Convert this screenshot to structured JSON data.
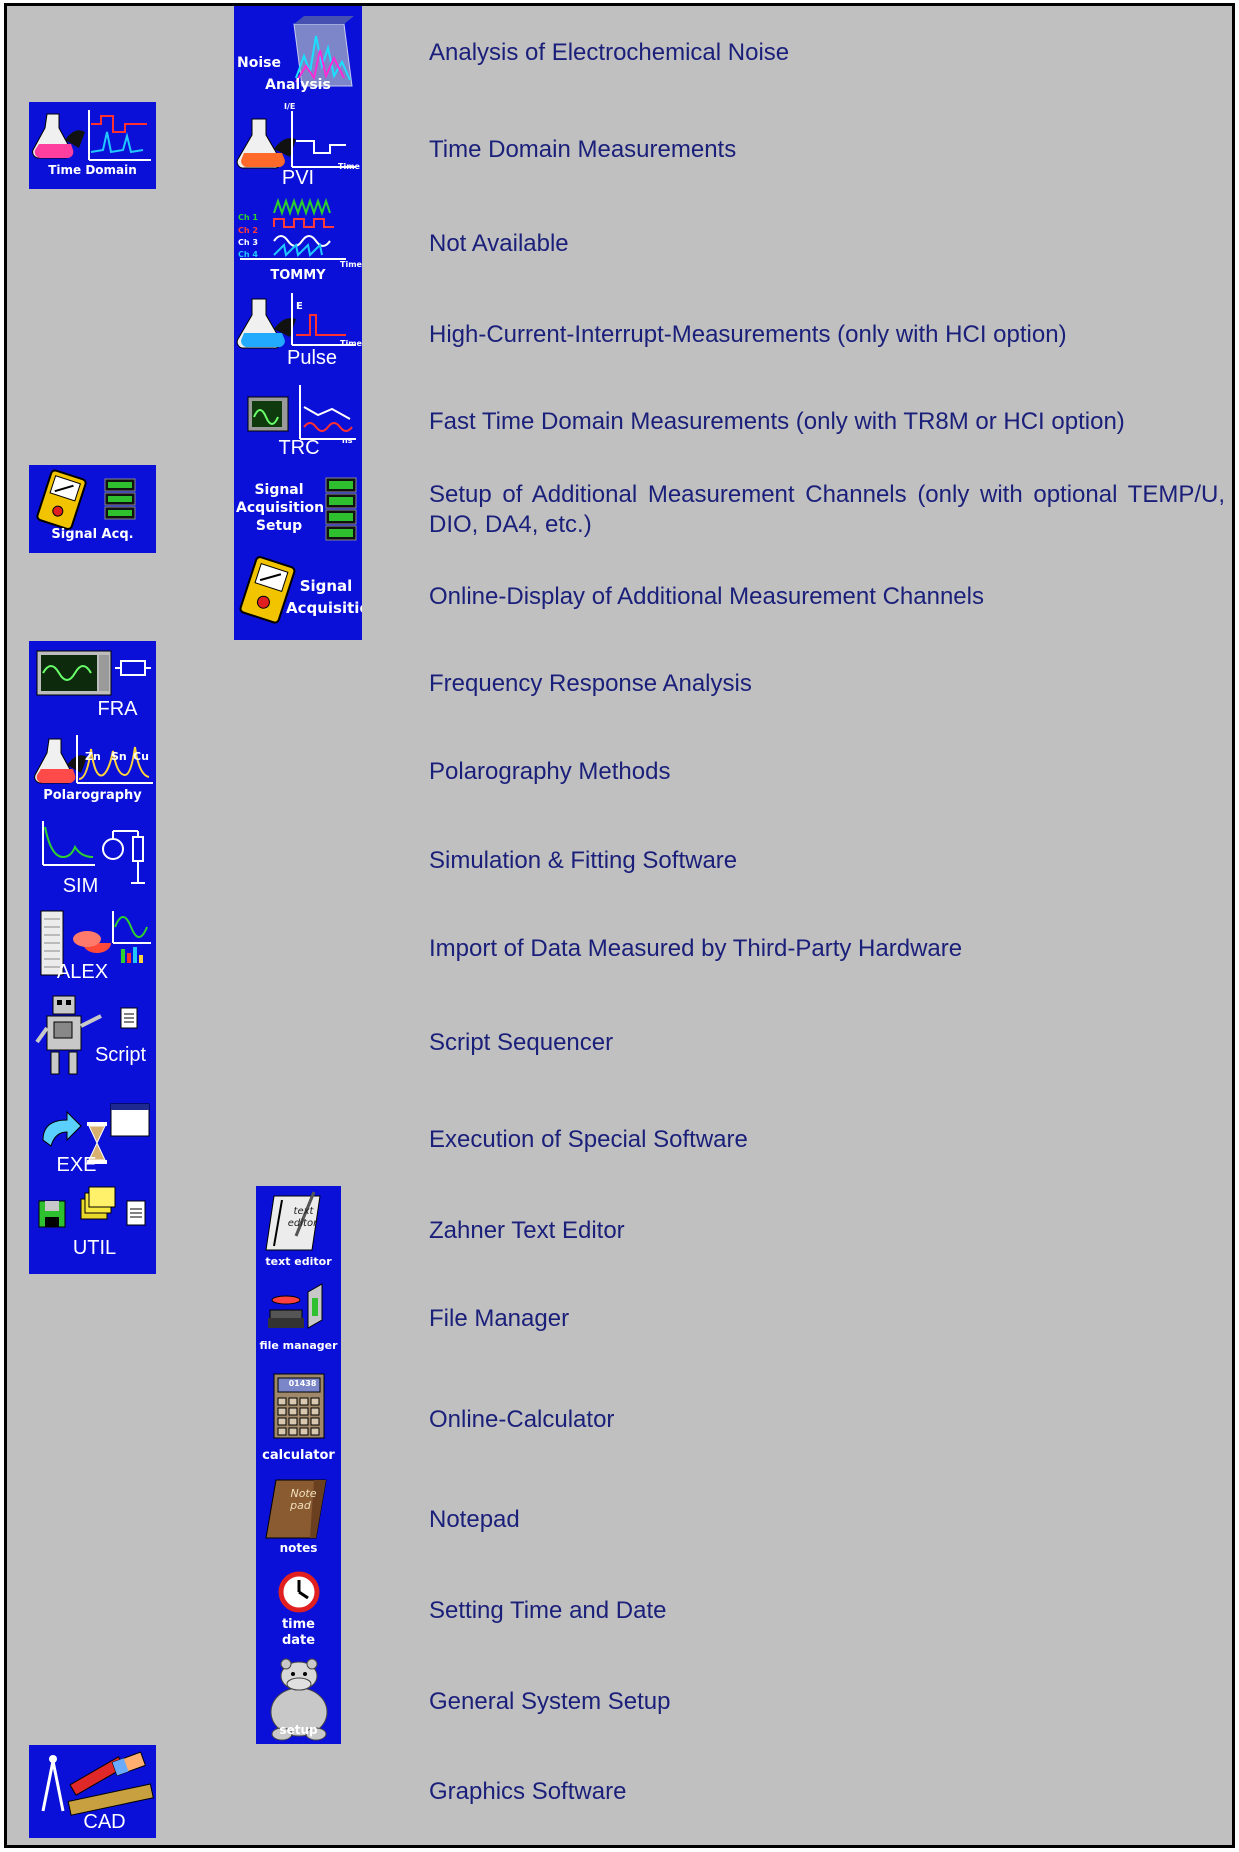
{
  "icons": {
    "noise": {
      "line1": "Noise",
      "line2": "Analysis"
    },
    "pvi": {
      "main": "PVI",
      "axis_y": "I/E",
      "axis_x": "Time"
    },
    "tommy": {
      "main": "TOMMY",
      "axis_x": "Time",
      "ch1": "Ch 1",
      "ch2": "Ch 2",
      "ch3": "Ch 3",
      "ch4": "Ch 4"
    },
    "pulse": {
      "main": "Pulse",
      "axis_y": "E",
      "axis_x": "Time"
    },
    "trc": {
      "main": "TRC",
      "axis_x": "ns"
    },
    "sigsetup": {
      "line1": "Signal",
      "line2": "Acquisition",
      "line3": "Setup"
    },
    "sigacq_big": {
      "line1": "Signal",
      "line2": "Acquisition"
    },
    "timedomain": {
      "label": "Time Domain"
    },
    "signalacq": {
      "label": "Signal Acq."
    },
    "fra": {
      "label": "FRA"
    },
    "polaro": {
      "label": "Polarography",
      "peak1": "Zn",
      "peak2": "Sn",
      "peak3": "Cu"
    },
    "sim": {
      "label": "SIM"
    },
    "alex": {
      "label": "ALEX"
    },
    "script": {
      "label": "Script"
    },
    "exe": {
      "label": "EXE"
    },
    "util": {
      "label": "UTIL"
    },
    "texteditor": {
      "label": "text editor",
      "book_line1": "text",
      "book_line2": "editor"
    },
    "filemanager": {
      "label": "file manager"
    },
    "calculator": {
      "label": "calculator",
      "display": "01438"
    },
    "notes": {
      "label": "notes",
      "book_line1": "Note",
      "book_line2": "pad"
    },
    "timedate": {
      "line1": "time",
      "line2": "date"
    },
    "setup": {
      "label": "setup"
    },
    "cad": {
      "label": "CAD"
    }
  },
  "descriptions": [
    "Analysis of Electrochemical Noise",
    "Time Domain Measurements",
    "Not Available",
    "High-Current-Interrupt-Measurements (only with HCI option)",
    "Fast Time Domain Measurements (only with TR8M or HCI option)",
    "Setup of Additional Measurement Channels (only with optional TEMP/U, DIO, DA4, etc.)",
    "Online-Display of Additional Measurement Channels",
    "Frequency Response Analysis",
    "Polarography Methods",
    "Simulation & Fitting Software",
    "Import of Data Measured by Third-Party Hardware",
    "Script Sequencer",
    "Execution of Special Software",
    "Zahner Text Editor",
    "File Manager",
    "Online-Calculator",
    "Notepad",
    "Setting Time and Date",
    "General System Setup",
    "Graphics Software"
  ]
}
